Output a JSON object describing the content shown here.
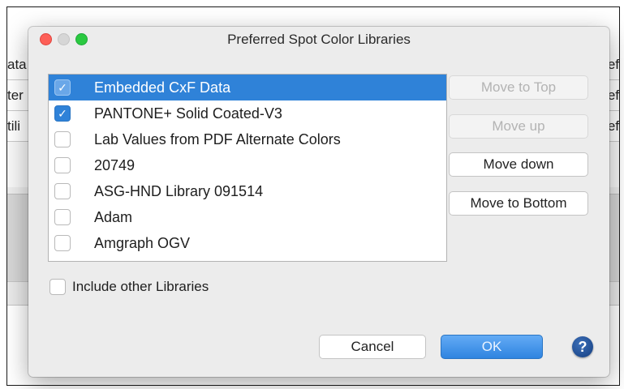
{
  "background": {
    "rows": [
      {
        "left": "ata",
        "right": "ef"
      },
      {
        "left": "ter",
        "right": "ef"
      },
      {
        "left": "tili",
        "right": "ef"
      }
    ]
  },
  "dialog": {
    "title": "Preferred Spot Color Libraries",
    "libraries": [
      {
        "label": "Embedded CxF Data",
        "checked": true,
        "selected": true
      },
      {
        "label": "PANTONE+ Solid Coated-V3",
        "checked": true,
        "selected": false
      },
      {
        "label": "Lab Values from PDF Alternate Colors",
        "checked": false,
        "selected": false
      },
      {
        "label": "20749",
        "checked": false,
        "selected": false
      },
      {
        "label": "ASG-HND Library 091514",
        "checked": false,
        "selected": false
      },
      {
        "label": "Adam",
        "checked": false,
        "selected": false
      },
      {
        "label": "Amgraph OGV",
        "checked": false,
        "selected": false
      },
      {
        "label": "",
        "checked": false,
        "selected": false
      }
    ],
    "buttons": {
      "move_to_top": "Move to Top",
      "move_up": "Move up",
      "move_down": "Move down",
      "move_to_bottom": "Move to Bottom",
      "cancel": "Cancel",
      "ok": "OK"
    },
    "include_other_label": "Include other Libraries",
    "help_glyph": "?",
    "check_glyph": "✓"
  },
  "colors": {
    "selection": "#2f82d8",
    "ok_button": "#2f84e0"
  }
}
